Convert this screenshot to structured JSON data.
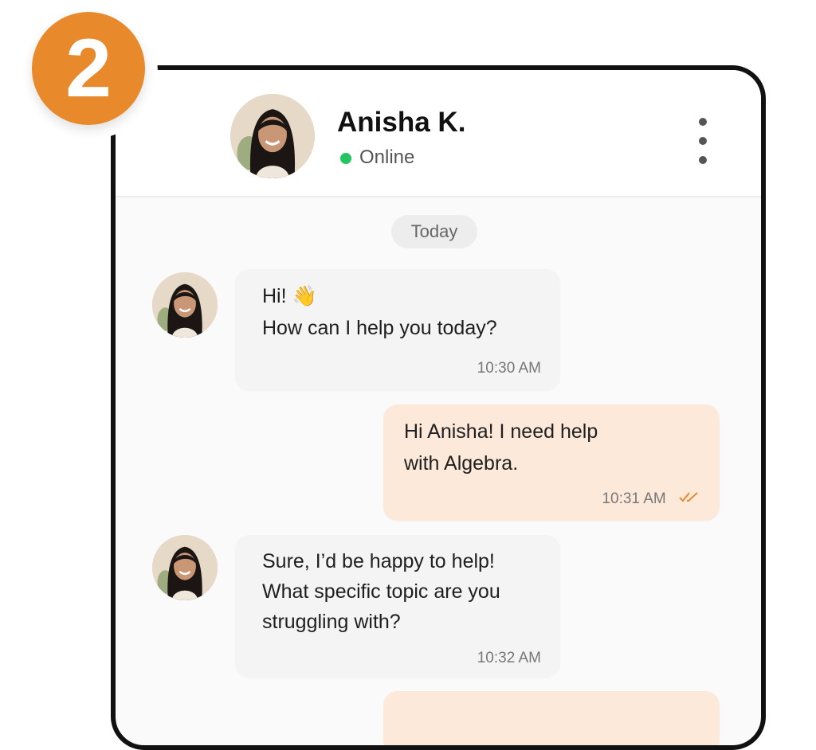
{
  "step": {
    "number": "2",
    "color": "#e8892b"
  },
  "header": {
    "name": "Anisha K.",
    "status": "Online",
    "status_color": "#22c55e",
    "menu_icon": "more-vertical-icon"
  },
  "date_divider": "Today",
  "messages": [
    {
      "direction": "incoming",
      "lines": [
        "Hi! 👋",
        "How can I help you today?"
      ],
      "time": "10:30 AM"
    },
    {
      "direction": "outgoing",
      "lines": [
        "Hi Anisha! I need help",
        "with Algebra."
      ],
      "time": "10:31 AM",
      "read_icon": "double-check-icon"
    },
    {
      "direction": "incoming",
      "lines": [
        "Sure, I’d be happy to help!",
        "What specific topic are you",
        "struggling with?"
      ],
      "time": "10:32 AM"
    }
  ],
  "colors": {
    "outgoing_bubble": "#fde9da",
    "incoming_bubble": "#f4f4f4",
    "accent": "#e8892b"
  }
}
